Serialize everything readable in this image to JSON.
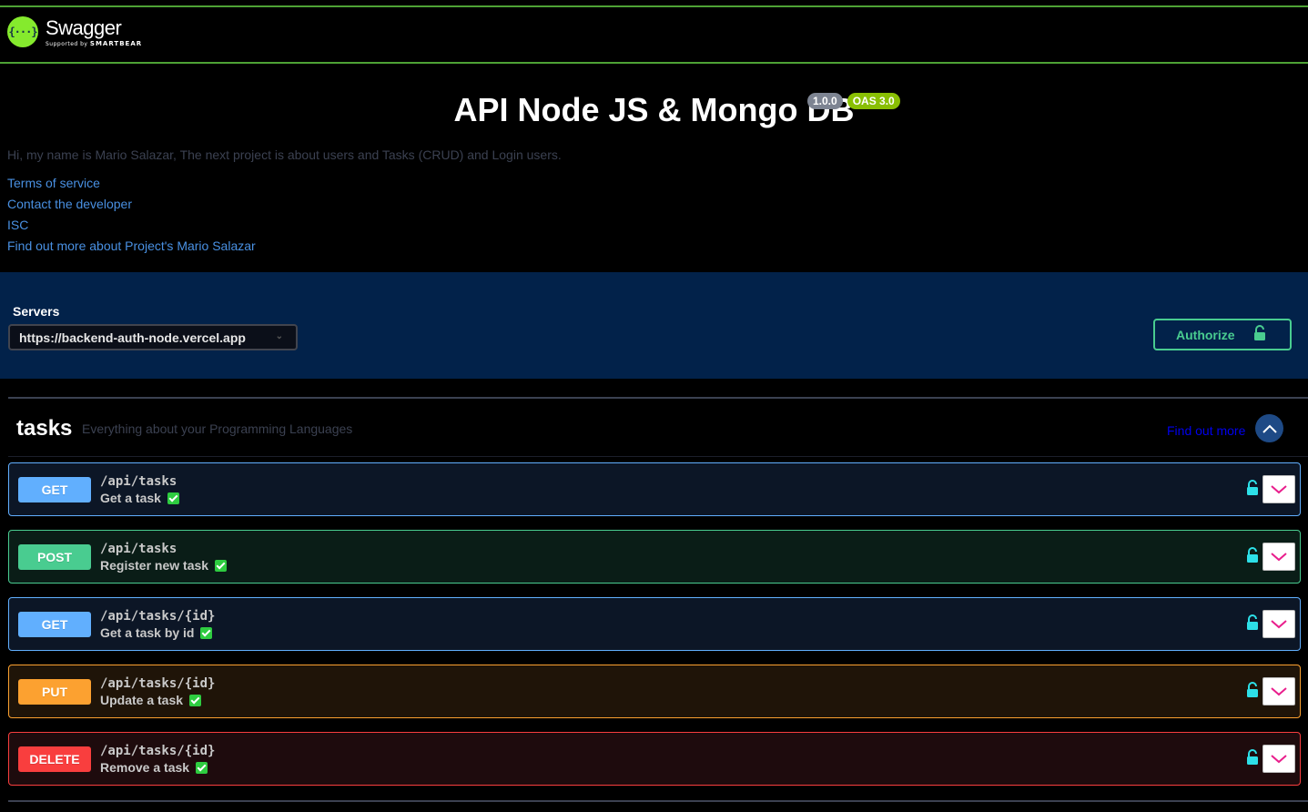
{
  "brand": {
    "name": "Swagger",
    "sub_prefix": "Supported by",
    "sub_company": "SMARTBEAR",
    "logo_glyph": "{···}"
  },
  "info": {
    "title": "API Node JS & Mongo DB",
    "version": "1.0.0",
    "oas": "OAS 3.0",
    "description": "Hi, my name is Mario Salazar, The next project is about users and Tasks (CRUD) and Login users.",
    "links": [
      "Terms of service",
      "Contact the developer",
      "ISC",
      "Find out more about Project's Mario Salazar"
    ]
  },
  "servers": {
    "label": "Servers",
    "selected": "https://backend-auth-node.vercel.app"
  },
  "authorize": {
    "label": "Authorize",
    "icon": "unlocked-icon",
    "color": "#49cc90"
  },
  "tag": {
    "name": "tasks",
    "description": "Everything about your Programming Languages",
    "more_label": "Find out more"
  },
  "operations": [
    {
      "method": "GET",
      "path": "/api/tasks",
      "summary": "Get a task"
    },
    {
      "method": "POST",
      "path": "/api/tasks",
      "summary": "Register new task"
    },
    {
      "method": "GET",
      "path": "/api/tasks/{id}",
      "summary": "Get a task by id"
    },
    {
      "method": "PUT",
      "path": "/api/tasks/{id}",
      "summary": "Update a task"
    },
    {
      "method": "DELETE",
      "path": "/api/tasks/{id}",
      "summary": "Remove a task"
    }
  ],
  "colors": {
    "get": "#61affe",
    "post": "#49cc90",
    "put": "#fca130",
    "delete": "#f93e3e",
    "accent": "#85ea2d",
    "servers_bg": "#02224a"
  }
}
